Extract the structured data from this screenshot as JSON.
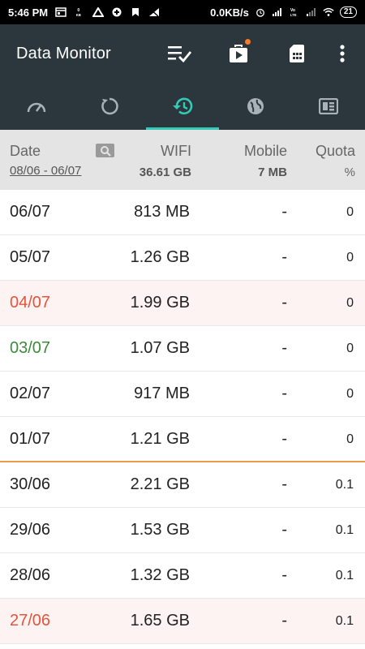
{
  "status_bar": {
    "time": "5:46 PM",
    "speed": "0.0KB/s",
    "small_kb": "0\nKB",
    "volte": "Vo\nLTE",
    "battery": "21"
  },
  "app_bar": {
    "title": "Data Monitor"
  },
  "tabs": [
    {
      "icon": "speedometer-icon",
      "active": false
    },
    {
      "icon": "refresh-icon",
      "active": false
    },
    {
      "icon": "history-icon",
      "active": true
    },
    {
      "icon": "globe-icon",
      "active": false
    },
    {
      "icon": "sim-card-icon",
      "active": false
    }
  ],
  "header": {
    "date_label": "Date",
    "date_range": "08/06 - 06/07",
    "wifi_label": "WIFI",
    "wifi_total": "36.61 GB",
    "mobile_label": "Mobile",
    "mobile_total": "7 MB",
    "quota_label": "Quota",
    "quota_unit": "%"
  },
  "rows": [
    {
      "date": "06/07",
      "wifi": "813 MB",
      "mobile": "-",
      "quota": "0"
    },
    {
      "date": "05/07",
      "wifi": "1.26 GB",
      "mobile": "-",
      "quota": "0"
    },
    {
      "date": "04/07",
      "wifi": "1.99 GB",
      "mobile": "-",
      "quota": "0"
    },
    {
      "date": "03/07",
      "wifi": "1.07 GB",
      "mobile": "-",
      "quota": "0"
    },
    {
      "date": "02/07",
      "wifi": "917 MB",
      "mobile": "-",
      "quota": "0"
    },
    {
      "date": "01/07",
      "wifi": "1.21 GB",
      "mobile": "-",
      "quota": "0"
    },
    {
      "date": "30/06",
      "wifi": "2.21 GB",
      "mobile": "-",
      "quota": "0.1"
    },
    {
      "date": "29/06",
      "wifi": "1.53 GB",
      "mobile": "-",
      "quota": "0.1"
    },
    {
      "date": "28/06",
      "wifi": "1.32 GB",
      "mobile": "-",
      "quota": "0.1"
    },
    {
      "date": "27/06",
      "wifi": "1.65 GB",
      "mobile": "-",
      "quota": "0.1"
    }
  ],
  "colors": {
    "toolbar": "#2b373d",
    "accent": "#36c9b7",
    "weekend_red": "#e5533a",
    "green": "#3c8a3c",
    "month_separator": "#e79b4b",
    "notification_dot": "#f57c2a"
  }
}
